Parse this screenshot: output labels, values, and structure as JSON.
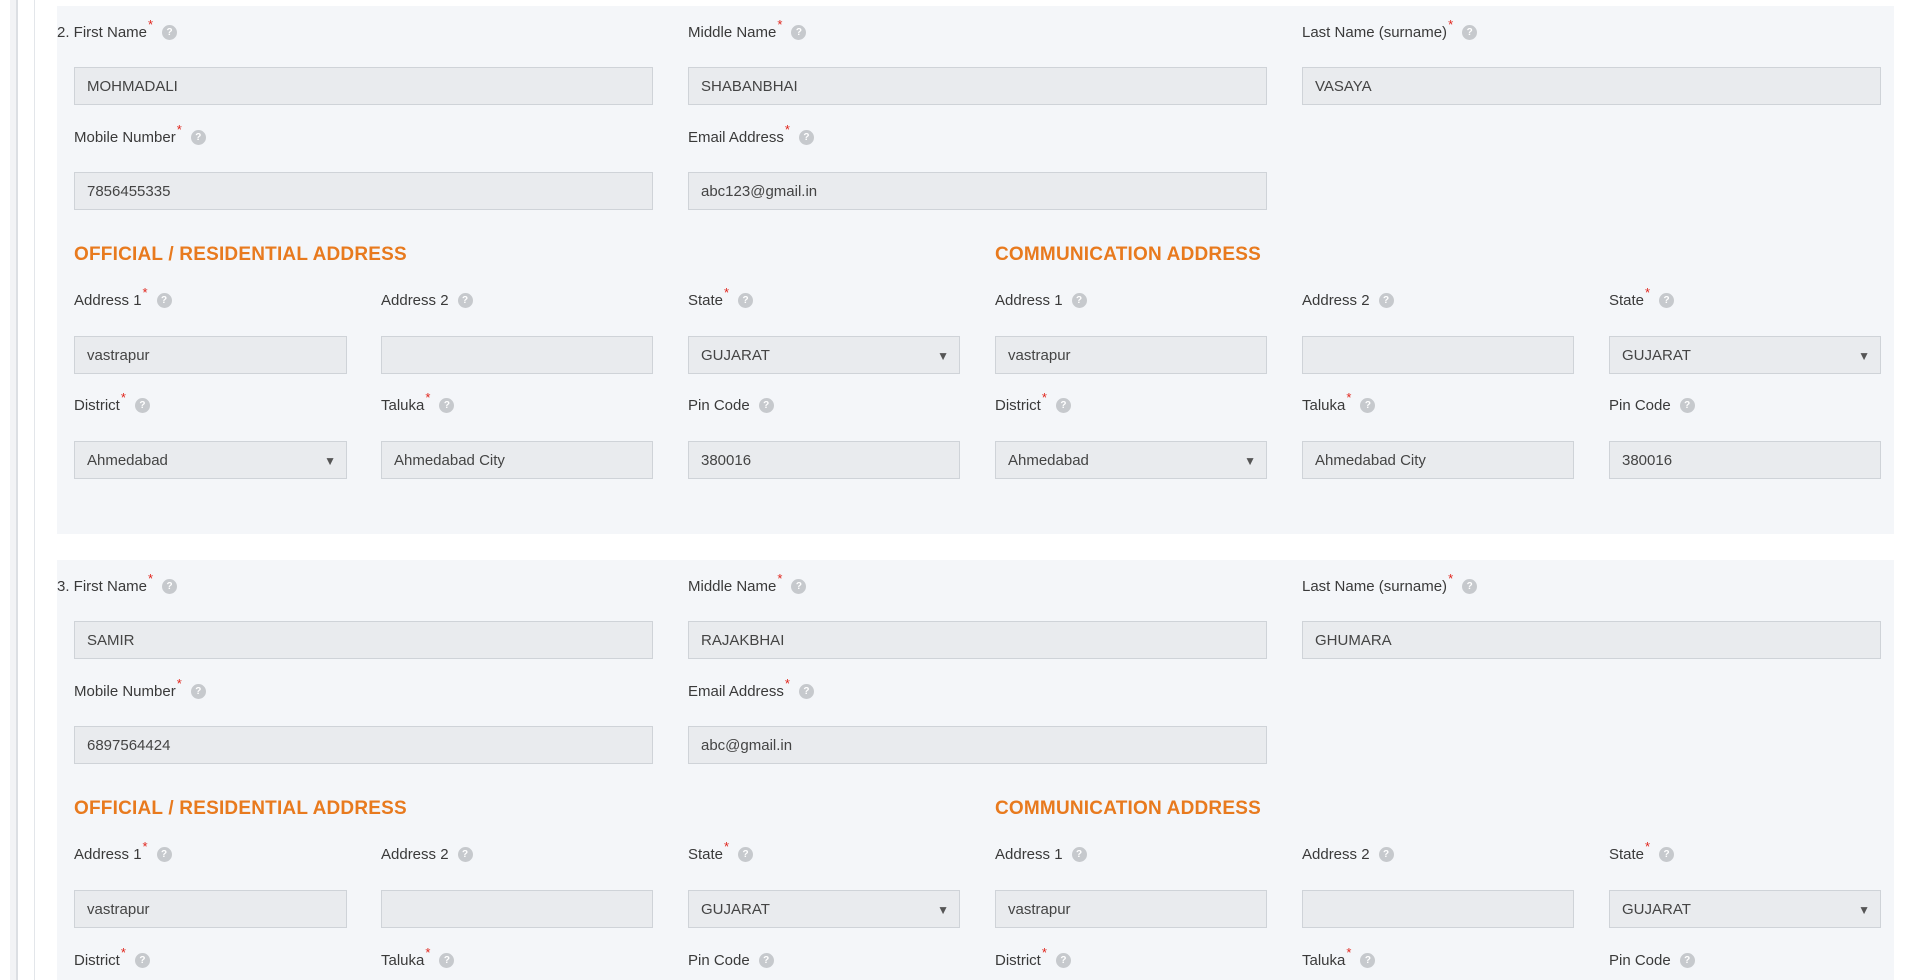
{
  "persons": [
    {
      "number_label": "2. First Name",
      "labels": {
        "middle_name": "Middle Name",
        "last_name": "Last Name (surname)",
        "mobile": "Mobile Number",
        "email": "Email Address"
      },
      "values": {
        "first_name": "MOHMADALI",
        "middle_name": "SHABANBHAI",
        "last_name": "VASAYA",
        "mobile": "7856455335",
        "email": "abc123@gmail.in"
      },
      "official_title": "OFFICIAL / RESIDENTIAL ADDRESS",
      "communication_title": "COMMUNICATION ADDRESS",
      "address_labels": {
        "address1": "Address 1",
        "address2": "Address 2",
        "state": "State",
        "district": "District",
        "taluka": "Taluka",
        "pin": "Pin Code"
      },
      "official": {
        "address1": "vastrapur",
        "address2": "",
        "state": "GUJARAT",
        "district": "Ahmedabad",
        "taluka": "Ahmedabad City",
        "pin": "380016"
      },
      "communication": {
        "address1": "vastrapur",
        "address2": "",
        "state": "GUJARAT",
        "district": "Ahmedabad",
        "taluka": "Ahmedabad City",
        "pin": "380016"
      }
    },
    {
      "number_label": "3. First Name",
      "labels": {
        "middle_name": "Middle Name",
        "last_name": "Last Name (surname)",
        "mobile": "Mobile Number",
        "email": "Email Address"
      },
      "values": {
        "first_name": "SAMIR",
        "middle_name": "RAJAKBHAI",
        "last_name": "GHUMARA",
        "mobile": "6897564424",
        "email": "abc@gmail.in"
      },
      "official_title": "OFFICIAL / RESIDENTIAL ADDRESS",
      "communication_title": "COMMUNICATION ADDRESS",
      "address_labels": {
        "address1": "Address 1",
        "address2": "Address 2",
        "state": "State",
        "district": "District",
        "taluka": "Taluka",
        "pin": "Pin Code"
      },
      "official": {
        "address1": "vastrapur",
        "address2": "",
        "state": "GUJARAT"
      },
      "communication": {
        "address1": "vastrapur",
        "address2": "",
        "state": "GUJARAT"
      }
    }
  ],
  "icons": {
    "help": "help-icon",
    "select_caret": "caret-down-icon",
    "help_glyph": "?",
    "caret_glyph": "▼",
    "required_glyph": "*"
  },
  "colors": {
    "section_title": "#e87a1e",
    "required": "#e0241b",
    "panel_bg": "#f4f6f9",
    "field_bg": "#e9ebee"
  }
}
